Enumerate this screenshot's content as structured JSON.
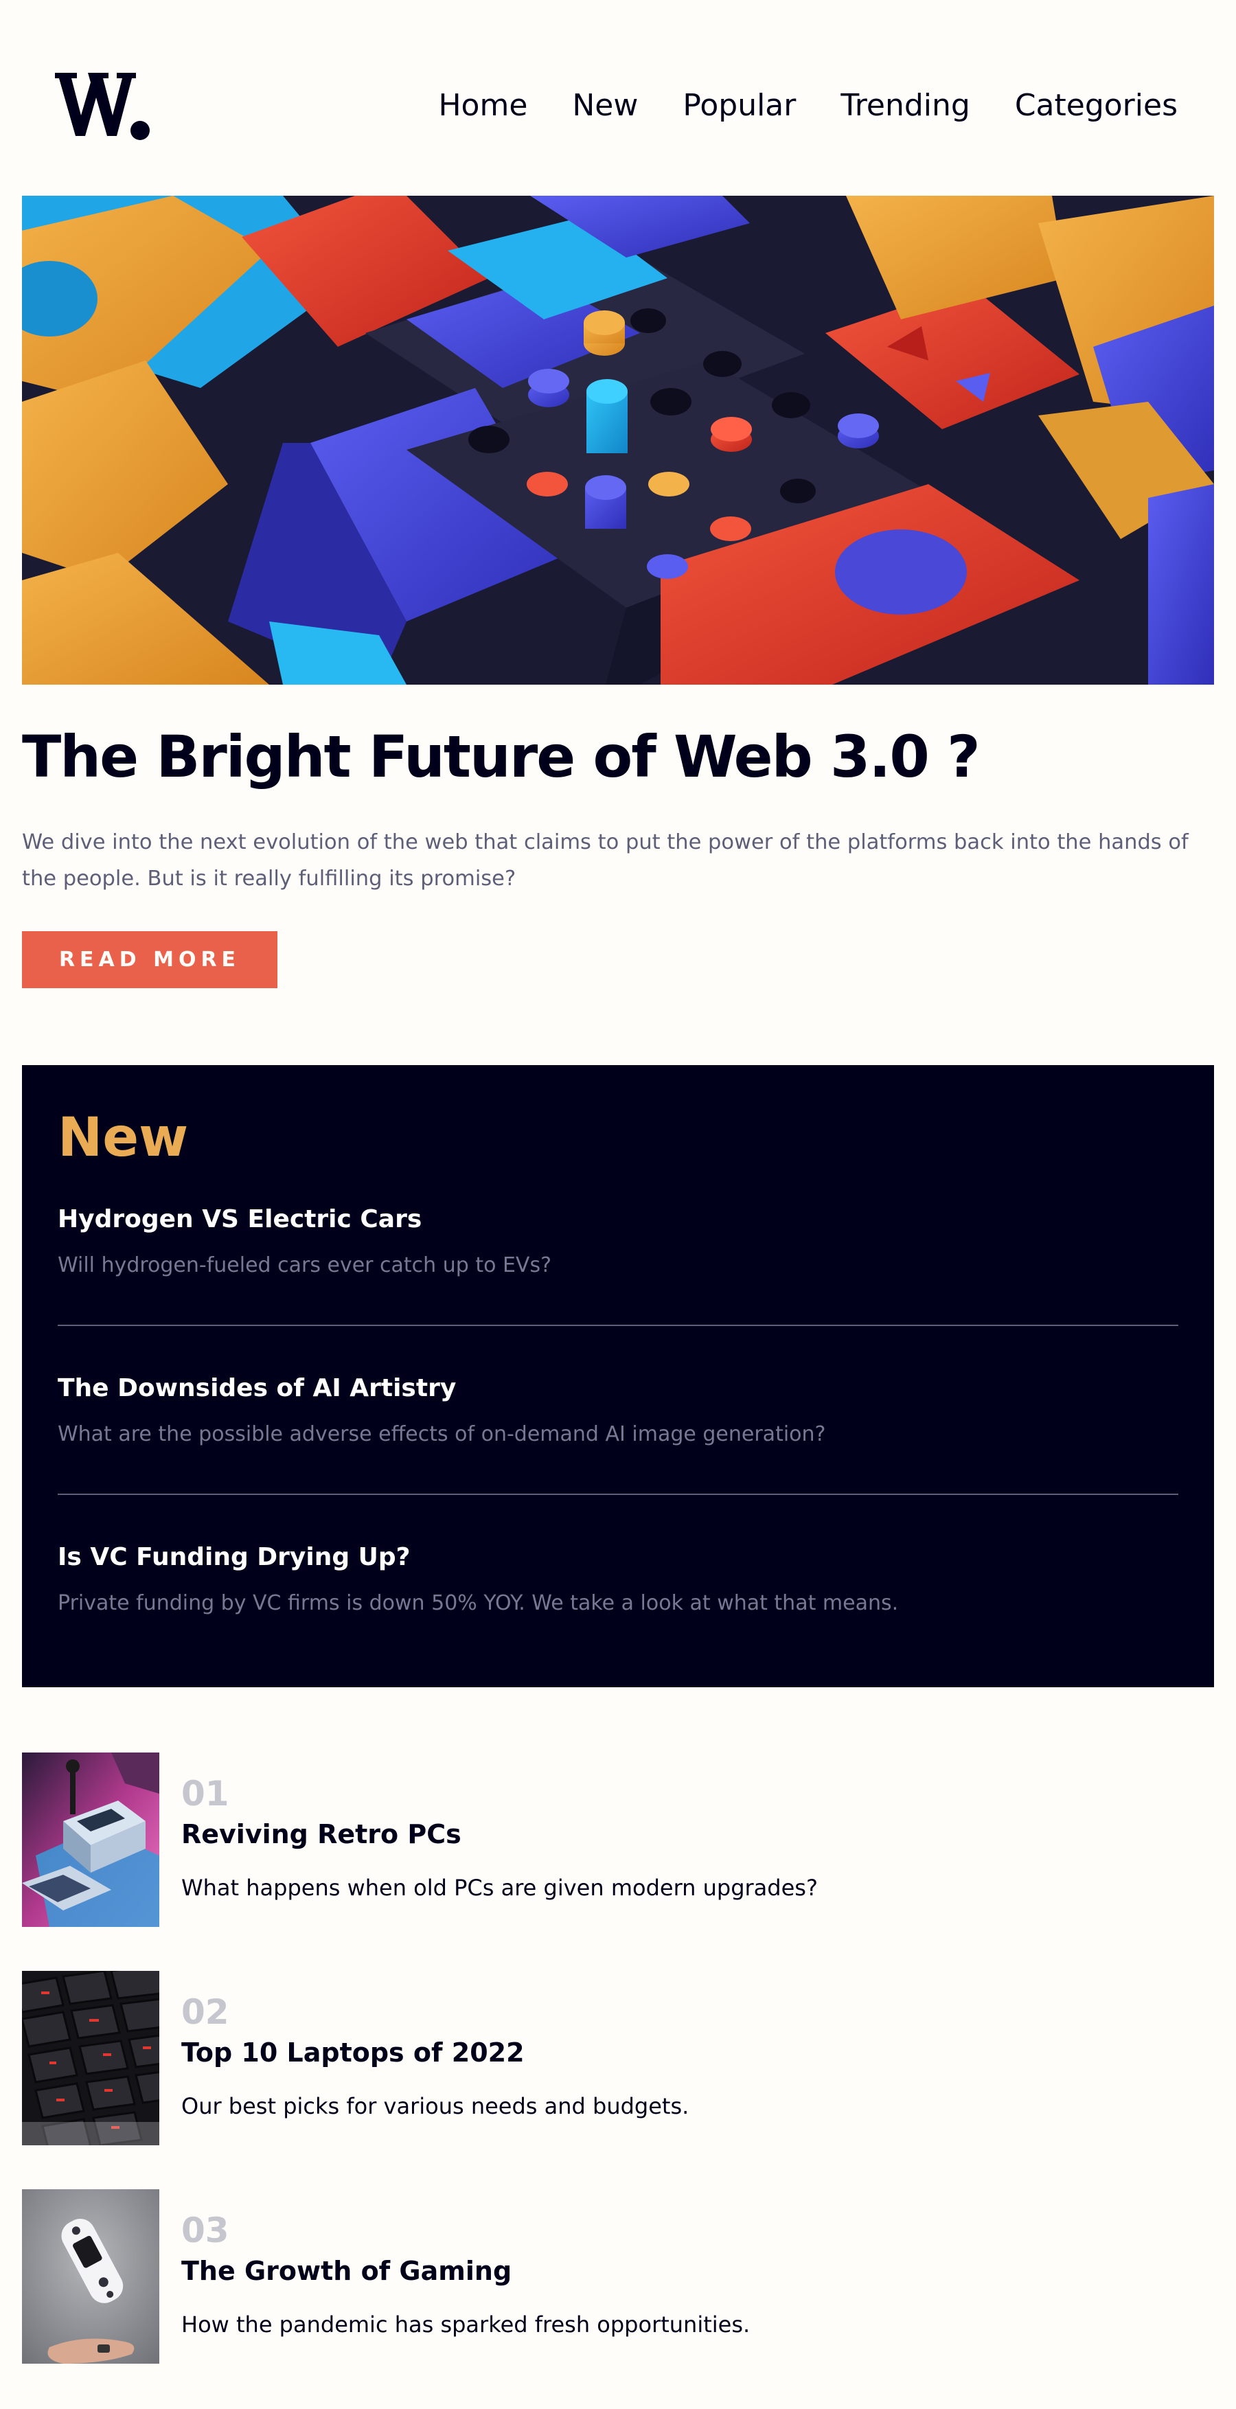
{
  "header": {
    "logo_text": "W.",
    "nav": [
      "Home",
      "New",
      "Popular",
      "Trending",
      "Categories"
    ]
  },
  "hero": {
    "image_icon": "abstract-3d-blocks-image",
    "title": "The Bright Future of Web 3.0 ?",
    "description": "We dive into the next evolution of the web that claims to put the power of the platforms back into the hands of the people. But is it really fulfilling its promise?",
    "cta_label": "READ MORE"
  },
  "new_section": {
    "title": "New",
    "items": [
      {
        "title": "Hydrogen VS Electric Cars",
        "description": "Will hydrogen-fueled cars ever catch up to EVs?"
      },
      {
        "title": "The Downsides of AI Artistry",
        "description": "What are the possible adverse effects of on-demand AI image generation?"
      },
      {
        "title": "Is VC Funding Drying Up?",
        "description": "Private funding by VC firms is down 50% YOY. We take a look at what that means."
      }
    ]
  },
  "ranked_articles": [
    {
      "number": "01",
      "title": "Reviving Retro PCs",
      "description": "What happens when old PCs are given modern upgrades?",
      "image_icon": "retro-pc-image"
    },
    {
      "number": "02",
      "title": "Top 10 Laptops of 2022",
      "description": "Our best picks for various needs and budgets.",
      "image_icon": "laptop-keyboard-image"
    },
    {
      "number": "03",
      "title": "The Growth of Gaming",
      "description": "How the pandemic has sparked fresh opportunities.",
      "image_icon": "game-controller-image"
    }
  ],
  "colors": {
    "background": "#fffdfa",
    "text_dark": "#00001a",
    "accent_red": "#e9614b",
    "accent_orange": "#e9ab53",
    "muted_text": "#5d5f79",
    "panel_text_muted": "#777990",
    "rank_number": "#c5c6ce"
  }
}
